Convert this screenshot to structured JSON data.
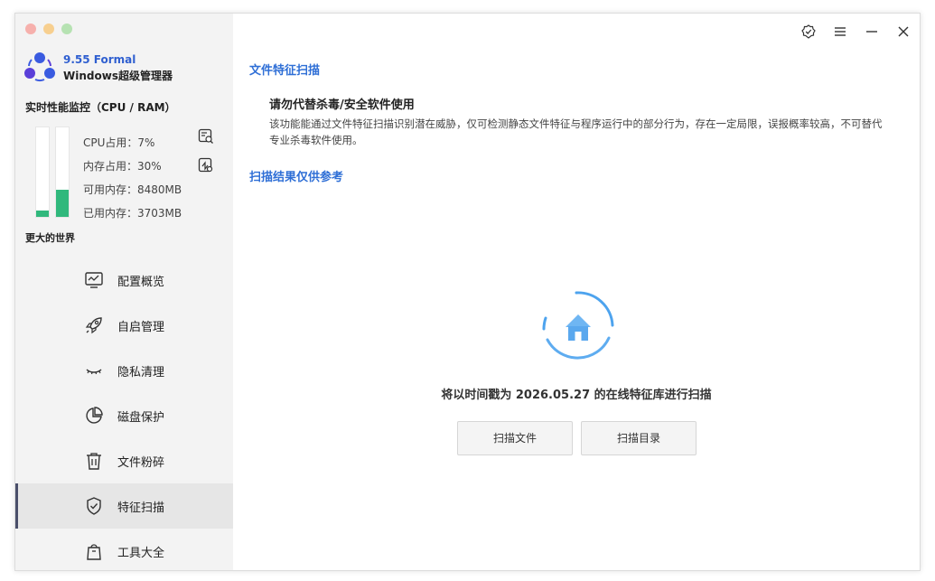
{
  "app": {
    "version": "9.55 Formal",
    "name": "Windows超级管理器"
  },
  "monitor": {
    "title": "实时性能监控（CPU / RAM）",
    "cpu_label": "CPU占用：7%",
    "mem_label": "内存占用：30%",
    "avail_label": "可用内存：8480MB",
    "used_label": "已用内存：3703MB",
    "cpu_percent": 7,
    "mem_percent": 30,
    "slogan": "更大的世界",
    "bar_color": "#30b87c"
  },
  "nav": {
    "items": [
      {
        "label": "配置概览",
        "icon": "monitor-chart-icon"
      },
      {
        "label": "自启管理",
        "icon": "rocket-icon"
      },
      {
        "label": "隐私清理",
        "icon": "closed-eye-icon"
      },
      {
        "label": "磁盘保护",
        "icon": "pie-chart-icon"
      },
      {
        "label": "文件粉碎",
        "icon": "trash-icon"
      },
      {
        "label": "特征扫描",
        "icon": "shield-check-icon",
        "active": true
      },
      {
        "label": "工具大全",
        "icon": "bag-icon"
      }
    ]
  },
  "main": {
    "section_title": "文件特征扫描",
    "warning_title": "请勿代替杀毒/安全软件使用",
    "warning_body": "该功能能通过文件特征扫描识别潜在威胁，仅可检测静态文件特征与程序运行中的部分行为，存在一定局限，误报概率较高，不可替代专业杀毒软件使用。",
    "result_note": "扫描结果仅供参考",
    "scan_status": "将以时间戳为 2026.05.27 的在线特征库进行扫描",
    "buttons": {
      "scan_file": "扫描文件",
      "scan_dir": "扫描目录"
    }
  },
  "colors": {
    "accent": "#2f6fd6",
    "sidebar_bg": "#f3f3f3",
    "spinner": "#4da3ee"
  }
}
